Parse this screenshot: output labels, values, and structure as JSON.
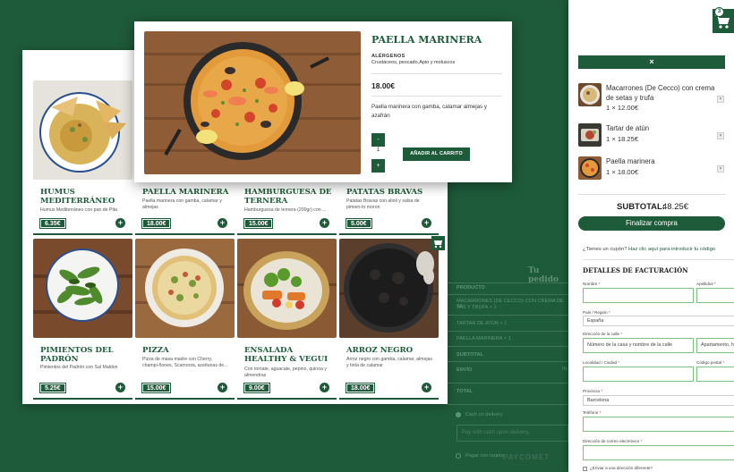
{
  "menu": {
    "items": [
      {
        "name": "HUMUS MEDITERRÁNEO",
        "desc": "Humus Mediterráneo con pan de Pita",
        "price": "6.35€"
      },
      {
        "name": "PAELLA MARINERA",
        "desc": "Paella marinera con gamba, calamar y almejas",
        "price": "18.00€"
      },
      {
        "name": "HAMBURGUESA DE TERNERA",
        "desc": "Hamburguesa de ternera (200gr) con ...",
        "price": "15.00€"
      },
      {
        "name": "PATATAS BRAVAS",
        "desc": "Patatas Bravas con alioli y salsa de pimien-to moron",
        "price": "5.00€"
      },
      {
        "name": "PIMIENTOS DEL PADRÓN",
        "desc": "Pimientos del Padrón con Sal Maldon",
        "price": "5.25€"
      },
      {
        "name": "PIZZA",
        "desc": "Pizza de masa madre con Cherry, champi-ñones, Scamorza, aceitunas de...",
        "price": "15.00€"
      },
      {
        "name": "ENSALADA HEALTHY & VEGUI",
        "desc": "Con tomate, aguacate, pepino, quinoa y almendras",
        "price": "9.00€"
      },
      {
        "name": "ARROZ NEGRO",
        "desc": "Arroz negro con gamba, calamar, almejas y tinta de calamar",
        "price": "18.00€"
      }
    ]
  },
  "detail": {
    "title": "PAELLA MARINERA",
    "allergens_label": "ALÉRGENOS",
    "allergens": "Crustáceos, pescado,Apio y moluscos",
    "price": "18.00€",
    "description": "Paella marinera con gamba, calamar almejas y azafrán",
    "qty_minus": "-",
    "qty": "1",
    "qty_plus": "+",
    "add_button": "AÑADIR AL CARRITO"
  },
  "order": {
    "title": "Tu pedido",
    "product_header": "PRODUCTO",
    "lines": [
      "MACARRONES (DE CECCO) CON CREMA DE SE-",
      "TAS Y TRUFA  × 1",
      "TARTAR DE ATÚN  × 1",
      "PAELLA MARINERA  × 1"
    ],
    "subtotal": "SUBTOTAL",
    "shipping": "ENVÍO",
    "shipping_value": "IN",
    "total": "TOTAL",
    "cash_label": "Cash on delivery",
    "cash_info": "Pay with cash upon delivery.",
    "card_label": "Pagar con tarjeta",
    "paycomet": "PAYCOMET"
  },
  "cart": {
    "count": "3",
    "close": "×",
    "items": [
      {
        "name": "Macarrones (De Cecco) con crema de setas y trufa",
        "qty": "1 × 12.00€"
      },
      {
        "name": "Tartar de atún",
        "qty": "1 × 18.25€"
      },
      {
        "name": "Paella marinera",
        "qty": "1 × 18.00€"
      }
    ],
    "remove": "×",
    "subtotal_label": "SUBTOTAL:",
    "subtotal_value": "48.25€",
    "checkout": "Finalizar compra",
    "coupon_question": "¿Tienes un cupón? ",
    "coupon_link": "Haz clic aquí para introducir tu código",
    "billing_title": "DETALLES DE FACTURACIÓN",
    "fields": {
      "first_name": "Nombre",
      "last_name": "Apellidos",
      "country": "País / Región",
      "country_value": "España",
      "address": "Dirección de la calle",
      "address_placeholder": "Número de la casa y nombre de la calle",
      "address2_placeholder": "Apartamento, habitación, etc.",
      "city": "Localidad / Ciudad",
      "postcode": "Código postal",
      "province": "Provincia",
      "province_value": "Barcelona",
      "phone": "Teléfono",
      "email": "Dirección de correo electrónico",
      "required": "*",
      "ship_other": "¿Enviar a una dirección diferente?"
    }
  },
  "colors": {
    "brand_green": "#1e5b3a",
    "field_border": "#7fbf7f"
  }
}
